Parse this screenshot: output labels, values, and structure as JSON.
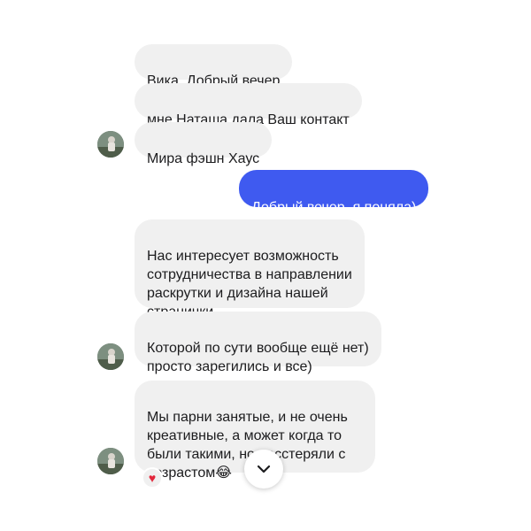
{
  "messages": [
    {
      "text": "Вика, Добрый вечер"
    },
    {
      "text": "мне Наташа дала Ваш контакт"
    },
    {
      "text": "Мира фэшн Хаус"
    },
    {
      "text": "Добрый вечер, я поняла)"
    },
    {
      "text": "Нас интересует возможность\nсотрудничества в направлении\nраскрутки и дизайна нашей\nстранички"
    },
    {
      "text": "Которой по сути вообще ещё нет)\nпросто зарегились и все)"
    },
    {
      "text": "Мы парни занятые, и не очень\nкреативные, а может когда то\nбыли такими, но расстеряли с\nвозрастом"
    }
  ],
  "reaction": {
    "icon": "heart-icon",
    "glyph": "♥",
    "color": "#e2263b"
  },
  "laugh_emoji": {
    "icon": "tears-of-joy-emoji",
    "glyph": "😂"
  },
  "scroll_button": {
    "icon": "chevron-down-icon"
  },
  "colors": {
    "incoming_bubble": "#f0f0f0",
    "outgoing_bubble": "#3f5af0",
    "text": "#1c1c1e"
  }
}
